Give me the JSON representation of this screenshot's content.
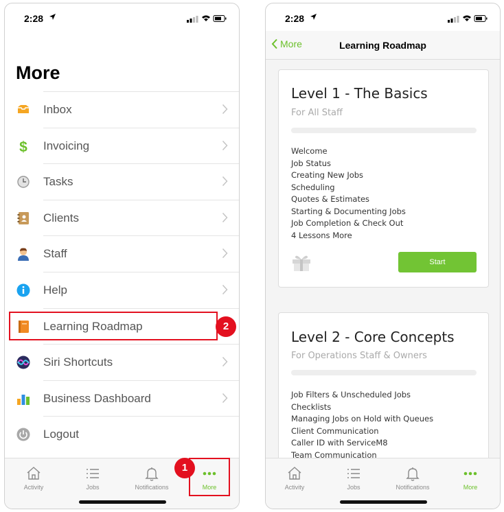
{
  "left_screen": {
    "status": {
      "time": "2:28"
    },
    "title": "More",
    "menu": [
      {
        "label": "Inbox",
        "icon": "inbox-icon",
        "color": "#f5a623"
      },
      {
        "label": "Invoicing",
        "icon": "dollar-icon",
        "color": "#6cc02b"
      },
      {
        "label": "Tasks",
        "icon": "clock-icon",
        "color": "#9a9a9a"
      },
      {
        "label": "Clients",
        "icon": "address-book-icon",
        "color": "#c89a5a"
      },
      {
        "label": "Staff",
        "icon": "staff-avatar-icon",
        "color": "#c8763c"
      },
      {
        "label": "Help",
        "icon": "info-icon",
        "color": "#1aa3f0"
      },
      {
        "label": "Learning Roadmap",
        "icon": "book-icon",
        "color": "#f08a24"
      },
      {
        "label": "Siri Shortcuts",
        "icon": "siri-icon",
        "color": "#5a3fd0"
      },
      {
        "label": "Business Dashboard",
        "icon": "bar-chart-icon",
        "color": "#2f8fe0"
      },
      {
        "label": "Logout",
        "icon": "power-icon",
        "color": "#9a9a9a"
      }
    ],
    "annotations": {
      "badge_1": "1",
      "badge_2": "2"
    },
    "tabs": [
      {
        "label": "Activity",
        "icon": "home-icon"
      },
      {
        "label": "Jobs",
        "icon": "list-icon"
      },
      {
        "label": "Notifications",
        "icon": "bell-icon"
      },
      {
        "label": "More",
        "icon": "more-dots-icon",
        "active": true
      }
    ]
  },
  "right_screen": {
    "status": {
      "time": "2:28"
    },
    "nav": {
      "back_label": "More",
      "title": "Learning Roadmap"
    },
    "cards": [
      {
        "title": "Level 1 - The Basics",
        "subtitle": "For All Staff",
        "progress": 0,
        "lessons": [
          "Welcome",
          "Job Status",
          "Creating New Jobs",
          "Scheduling",
          "Quotes & Estimates",
          "Starting & Documenting Jobs",
          "Job Completion & Check Out",
          "4 Lessons More"
        ],
        "button_label": "Start"
      },
      {
        "title": "Level 2 - Core Concepts",
        "subtitle": "For Operations Staff & Owners",
        "progress": 0,
        "lessons": [
          "Job Filters & Unscheduled Jobs",
          "Checklists",
          "Managing Jobs on Hold with Queues",
          "Client Communication",
          "Caller ID with ServiceM8",
          "Team Communication"
        ]
      }
    ],
    "tabs": [
      {
        "label": "Activity",
        "icon": "home-icon"
      },
      {
        "label": "Jobs",
        "icon": "list-icon"
      },
      {
        "label": "Notifications",
        "icon": "bell-icon"
      },
      {
        "label": "More",
        "icon": "more-dots-icon",
        "active": true
      }
    ]
  },
  "colors": {
    "accent": "#6cc02b",
    "annotation_red": "#e3101f"
  }
}
